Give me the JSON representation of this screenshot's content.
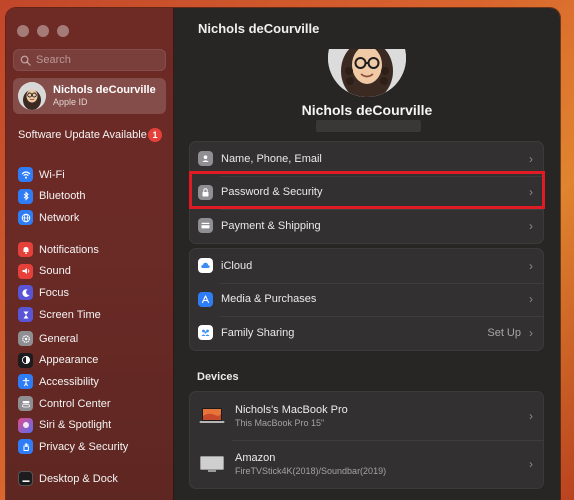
{
  "sidebar": {
    "search_placeholder": "Search",
    "profile": {
      "name": "Nichols deCourville",
      "subtitle": "Apple ID"
    },
    "update": {
      "label": "Software Update Available",
      "count": "1"
    },
    "group1": [
      {
        "label": "Wi-Fi",
        "icon": "wifi-icon",
        "color": "#2f7df6"
      },
      {
        "label": "Bluetooth",
        "icon": "bluetooth-icon",
        "color": "#2f7df6"
      },
      {
        "label": "Network",
        "icon": "globe-icon",
        "color": "#2f7df6"
      }
    ],
    "group2": [
      {
        "label": "Notifications",
        "icon": "bell-icon",
        "color": "#e5413a"
      },
      {
        "label": "Sound",
        "icon": "speaker-icon",
        "color": "#e5413a"
      },
      {
        "label": "Focus",
        "icon": "moon-icon",
        "color": "#5a55d6"
      },
      {
        "label": "Screen Time",
        "icon": "hourglass-icon",
        "color": "#5a55d6"
      }
    ],
    "group3": [
      {
        "label": "General",
        "icon": "gear-icon",
        "color": "#8e8e93"
      },
      {
        "label": "Appearance",
        "icon": "appearance-icon",
        "color": "#1c1c1e"
      },
      {
        "label": "Accessibility",
        "icon": "accessibility-icon",
        "color": "#2f7df6"
      },
      {
        "label": "Control Center",
        "icon": "control-center-icon",
        "color": "#8e8e93"
      },
      {
        "label": "Siri & Spotlight",
        "icon": "siri-icon",
        "color": "#a34bd6"
      },
      {
        "label": "Privacy & Security",
        "icon": "hand-icon",
        "color": "#2f7df6"
      }
    ],
    "group4": [
      {
        "label": "Desktop & Dock",
        "icon": "dock-icon",
        "color": "#1c1c1e"
      }
    ]
  },
  "main": {
    "title": "Nichols deCourville",
    "hero_name": "Nichols deCourville",
    "account_rows": [
      {
        "label": "Name, Phone, Email",
        "icon": "contact-card-icon",
        "color": "#8e8e93"
      },
      {
        "label": "Password & Security",
        "icon": "lock-icon",
        "color": "#8e8e93"
      },
      {
        "label": "Payment & Shipping",
        "icon": "credit-card-icon",
        "color": "#8e8e93"
      }
    ],
    "service_rows": [
      {
        "label": "iCloud",
        "icon": "icloud-icon",
        "color": "#ffffff",
        "value": ""
      },
      {
        "label": "Media & Purchases",
        "icon": "app-store-icon",
        "color": "#2f7df6",
        "value": ""
      },
      {
        "label": "Family Sharing",
        "icon": "family-icon",
        "color": "#ffffff",
        "value": "Set Up"
      }
    ],
    "devices_label": "Devices",
    "devices": [
      {
        "name": "Nichols's MacBook Pro",
        "detail": "This MacBook Pro 15\"",
        "icon": "macbook-icon"
      },
      {
        "name": "Amazon",
        "detail": "FireTVStick4K(2018)/Soundbar(2019)",
        "icon": "tv-icon"
      }
    ]
  },
  "colors": {
    "highlight": "#e01b24",
    "sidebar_bg": "#6a2a26",
    "main_bg": "#282625",
    "badge": "#e5413a"
  }
}
